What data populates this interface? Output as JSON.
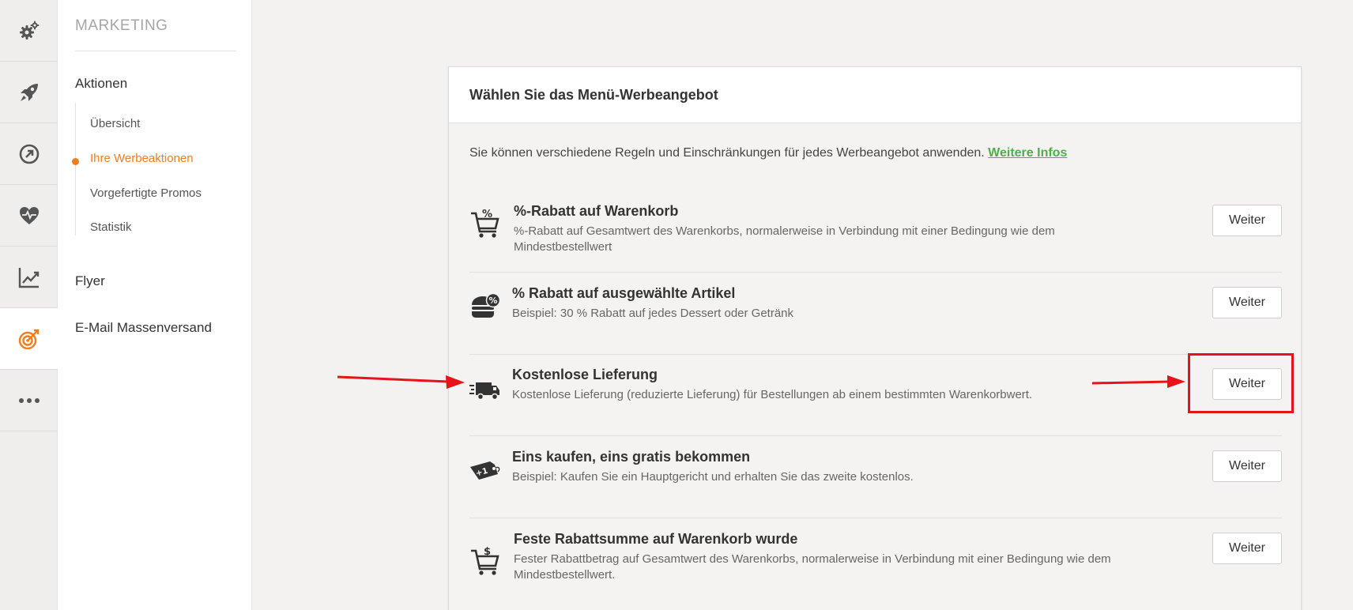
{
  "rail": {
    "items": [
      {
        "icon": "gears-icon",
        "active": false
      },
      {
        "icon": "rocket-icon",
        "active": false
      },
      {
        "icon": "dashboard-icon",
        "active": false
      },
      {
        "icon": "heart-pulse-icon",
        "active": false
      },
      {
        "icon": "line-chart-icon",
        "active": false
      },
      {
        "icon": "target-icon",
        "active": true
      },
      {
        "icon": "more-icon",
        "active": false
      }
    ]
  },
  "submenu": {
    "section_title": "MARKETING",
    "groups": {
      "aktionen": "Aktionen",
      "flyer": "Flyer",
      "email": "E-Mail Massenversand"
    },
    "links": {
      "uebersicht": "Übersicht",
      "werbeaktionen": "Ihre Werbeaktionen",
      "promos": "Vorgefertigte Promos",
      "statistik": "Statistik"
    }
  },
  "card": {
    "header": "Wählen Sie das Menü-Werbeangebot",
    "intro": "Sie können verschiedene Regeln und Einschränkungen für jedes Werbeangebot anwenden.",
    "intro_link": "Weitere Infos",
    "button_label": "Weiter",
    "offers": [
      {
        "icon": "cart-percent-icon",
        "title": "%-Rabatt auf Warenkorb",
        "desc": "%-Rabatt auf Gesamtwert des Warenkorbs, normalerweise in Verbindung mit einer Bedingung wie dem Mindestbestellwert"
      },
      {
        "icon": "burger-percent-icon",
        "title": "% Rabatt auf ausgewählte Artikel",
        "desc": "Beispiel: 30 % Rabatt auf jedes Dessert oder Getränk"
      },
      {
        "icon": "delivery-truck-icon",
        "title": "Kostenlose Lieferung",
        "desc": "Kostenlose Lieferung (reduzierte Lieferung) für Bestellungen ab einem bestimmten Warenkorbwert."
      },
      {
        "icon": "tag-plus-one-icon",
        "title": "Eins kaufen, eins gratis bekommen",
        "desc": "Beispiel: Kaufen Sie ein Hauptgericht und erhalten Sie das zweite kostenlos."
      },
      {
        "icon": "cart-dollar-icon",
        "title": "Feste Rabattsumme auf Warenkorb wurde",
        "desc": "Fester Rabattbetrag auf Gesamtwert des Warenkorbs, normalerweise in Verbindung mit einer Bedingung wie dem Mindestbestellwert."
      }
    ]
  },
  "colors": {
    "accent": "#f07d1e",
    "link": "#4caf50",
    "annotation": "#e8121a"
  }
}
